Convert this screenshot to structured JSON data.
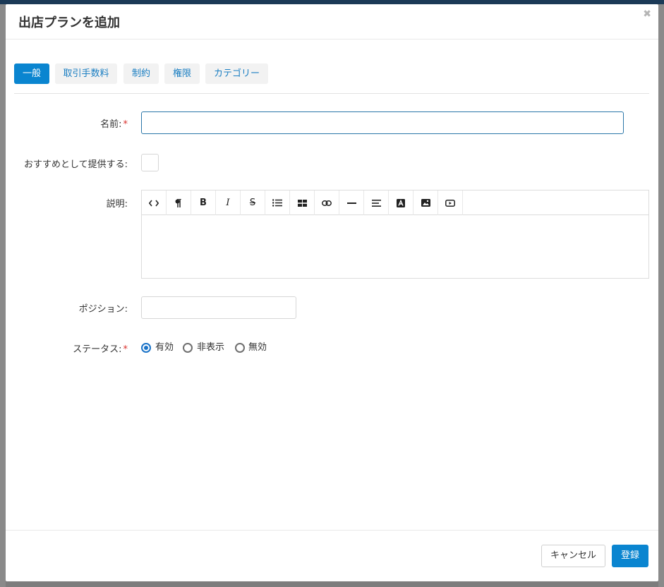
{
  "modal": {
    "title": "出店プランを追加",
    "close_icon": "close-icon"
  },
  "tabs": [
    {
      "label": "一般",
      "active": true
    },
    {
      "label": "取引手数料",
      "active": false
    },
    {
      "label": "制約",
      "active": false
    },
    {
      "label": "権限",
      "active": false
    },
    {
      "label": "カテゴリー",
      "active": false
    }
  ],
  "form": {
    "name": {
      "label": "名前:",
      "required_mark": "*",
      "value": ""
    },
    "featured": {
      "label": "おすすめとして提供する:",
      "checked": false
    },
    "description": {
      "label": "説明:",
      "toolbar_icons": [
        "code-view-icon",
        "paragraph-icon",
        "bold-icon",
        "italic-icon",
        "strikethrough-icon",
        "list-icon",
        "table-icon",
        "link-icon",
        "horizontal-rule-icon",
        "align-icon",
        "text-color-icon",
        "image-icon",
        "video-icon"
      ],
      "value": ""
    },
    "position": {
      "label": "ポジション:",
      "value": ""
    },
    "status": {
      "label": "ステータス:",
      "required_mark": "*",
      "options": [
        "有効",
        "非表示",
        "無効"
      ],
      "selected": "有効"
    }
  },
  "footer": {
    "cancel_label": "キャンセル",
    "submit_label": "登録"
  },
  "colors": {
    "primary": "#0a85d0",
    "required": "#d9302c",
    "tab_text": "#1a7ec2"
  }
}
